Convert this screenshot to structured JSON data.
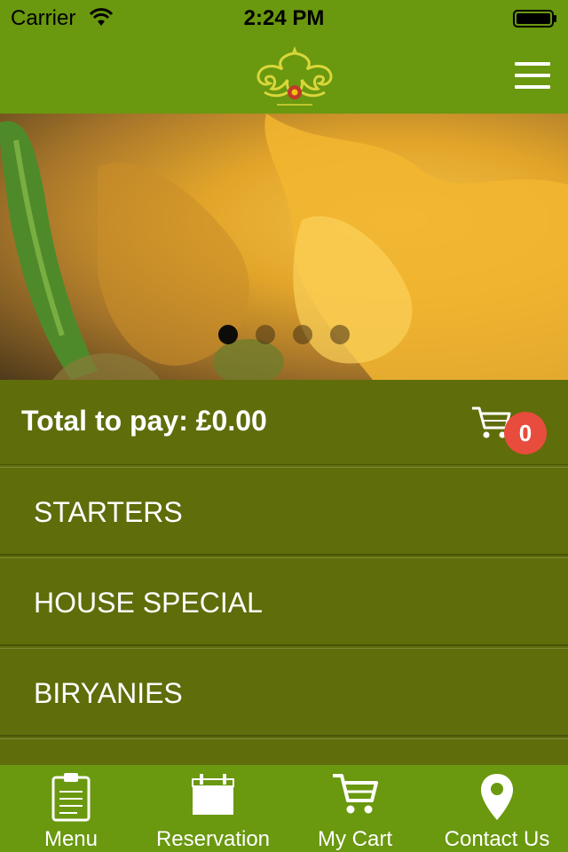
{
  "status_bar": {
    "carrier": "Carrier",
    "time": "2:24 PM"
  },
  "header": {
    "logo": "ornamental-logo",
    "menu_icon": "hamburger-menu-icon"
  },
  "hero": {
    "slides": 4,
    "active_slide": 1
  },
  "cart_summary": {
    "total_label": "Total to pay: £0.00",
    "item_count": "0"
  },
  "categories": [
    {
      "label": "STARTERS"
    },
    {
      "label": "HOUSE SPECIAL"
    },
    {
      "label": "BIRYANIES"
    }
  ],
  "tabs": [
    {
      "label": "Menu",
      "icon": "clipboard-icon"
    },
    {
      "label": "Reservation",
      "icon": "calendar-icon"
    },
    {
      "label": "My Cart",
      "icon": "cart-icon"
    },
    {
      "label": "Contact Us",
      "icon": "location-pin-icon"
    }
  ],
  "colors": {
    "bar_green": "#6a980f",
    "olive": "#5f6d0a",
    "badge_red": "#e84c3d"
  }
}
